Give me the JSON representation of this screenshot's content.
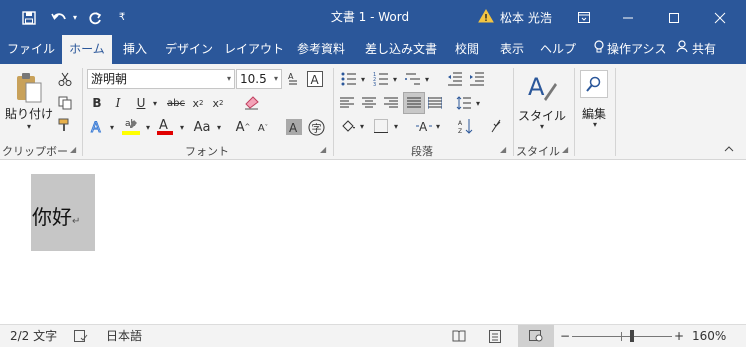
{
  "titlebar": {
    "title": "文書 1  -  Word",
    "user": "松本 光浩",
    "icons": [
      "save-icon",
      "undo-icon",
      "redo-icon",
      "customize-qat-icon",
      "warning-icon",
      "ribbon-display-icon",
      "minimize-icon",
      "maximize-icon",
      "close-icon"
    ]
  },
  "tabs": [
    "ファイル",
    "ホーム",
    "挿入",
    "デザイン",
    "レイアウト",
    "参考資料",
    "差し込み文書",
    "校閲",
    "表示",
    "ヘルプ",
    "操作アシス",
    "共有"
  ],
  "ribbon": {
    "clipboard": {
      "paste_label": "貼り付け",
      "group_label": "クリップボード"
    },
    "font": {
      "font_name": "游明朝",
      "font_size": "10.5",
      "group_label": "フォント",
      "highlight_color": "#ffff00",
      "font_color": "#e00000"
    },
    "paragraph": {
      "group_label": "段落"
    },
    "styles": {
      "button_label": "スタイル",
      "group_label": "スタイル"
    },
    "editing": {
      "button_label": "編集"
    }
  },
  "document": {
    "text": "你好"
  },
  "statusbar": {
    "page": "2/2 文字",
    "language": "日本語",
    "zoom": "160%",
    "zoom_level": 0.6
  },
  "colors": {
    "accent": "#2b579a",
    "ribbon_bg": "#f3f3f3",
    "selection": "#c6c6c6"
  }
}
